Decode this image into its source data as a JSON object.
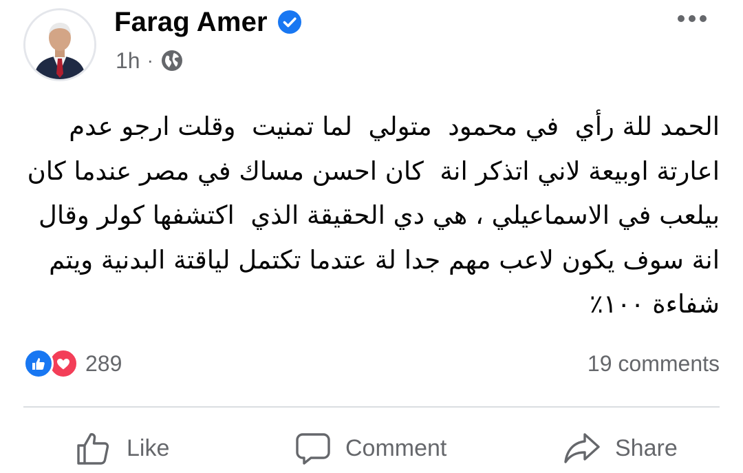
{
  "author": {
    "name": "Farag Amer",
    "verified": true
  },
  "meta": {
    "time": "1h",
    "separator": "·",
    "audience_icon": "globe-icon"
  },
  "post": {
    "lines": [
      "الحمد للة رأي  في محمود  متولي  لما تمنيت  وقلت ارجو عدم",
      "اعارتة اوبيعة لاني اتذكر انة  كان احسن مساك في مصر عندما كان",
      "بيلعب في الاسماعيلي ، هي دي الحقيقة الذي  اكتشفها كولر وقال",
      "انة سوف يكون لاعب مهم جدا لة عتدما تكتمل لياقتة البدنية ويتم",
      "شفاءة ١٠٠٪"
    ]
  },
  "reactions": {
    "icons": [
      "like-icon",
      "love-icon"
    ],
    "count": "289",
    "comments": "19 comments"
  },
  "actions": {
    "like": "Like",
    "comment": "Comment",
    "share": "Share"
  },
  "colors": {
    "verified": "#1877f2",
    "like": "#1877f2",
    "love": "#f33e58",
    "secondary_text": "#65676b"
  }
}
